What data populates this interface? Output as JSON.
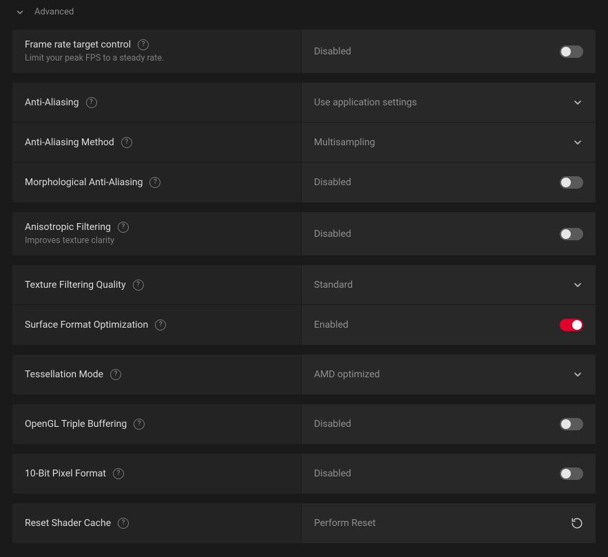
{
  "section": {
    "title": "Advanced"
  },
  "values": {
    "disabled": "Disabled",
    "enabled": "Enabled"
  },
  "rows": {
    "frameRate": {
      "label": "Frame rate target control",
      "desc": "Limit your peak FPS to a steady rate.",
      "value": "Disabled"
    },
    "antiAliasing": {
      "label": "Anti-Aliasing",
      "value": "Use application settings"
    },
    "aaMethod": {
      "label": "Anti-Aliasing Method",
      "value": "Multisampling"
    },
    "morphAA": {
      "label": "Morphological Anti-Aliasing",
      "value": "Disabled"
    },
    "aniso": {
      "label": "Anisotropic Filtering",
      "desc": "Improves texture clarity",
      "value": "Disabled"
    },
    "texQuality": {
      "label": "Texture Filtering Quality",
      "value": "Standard"
    },
    "surfaceOpt": {
      "label": "Surface Format Optimization",
      "value": "Enabled"
    },
    "tess": {
      "label": "Tessellation Mode",
      "value": "AMD optimized"
    },
    "triple": {
      "label": "OpenGL Triple Buffering",
      "value": "Disabled"
    },
    "tenbit": {
      "label": "10-Bit Pixel Format",
      "value": "Disabled"
    },
    "shader": {
      "label": "Reset Shader Cache",
      "value": "Perform Reset"
    }
  }
}
